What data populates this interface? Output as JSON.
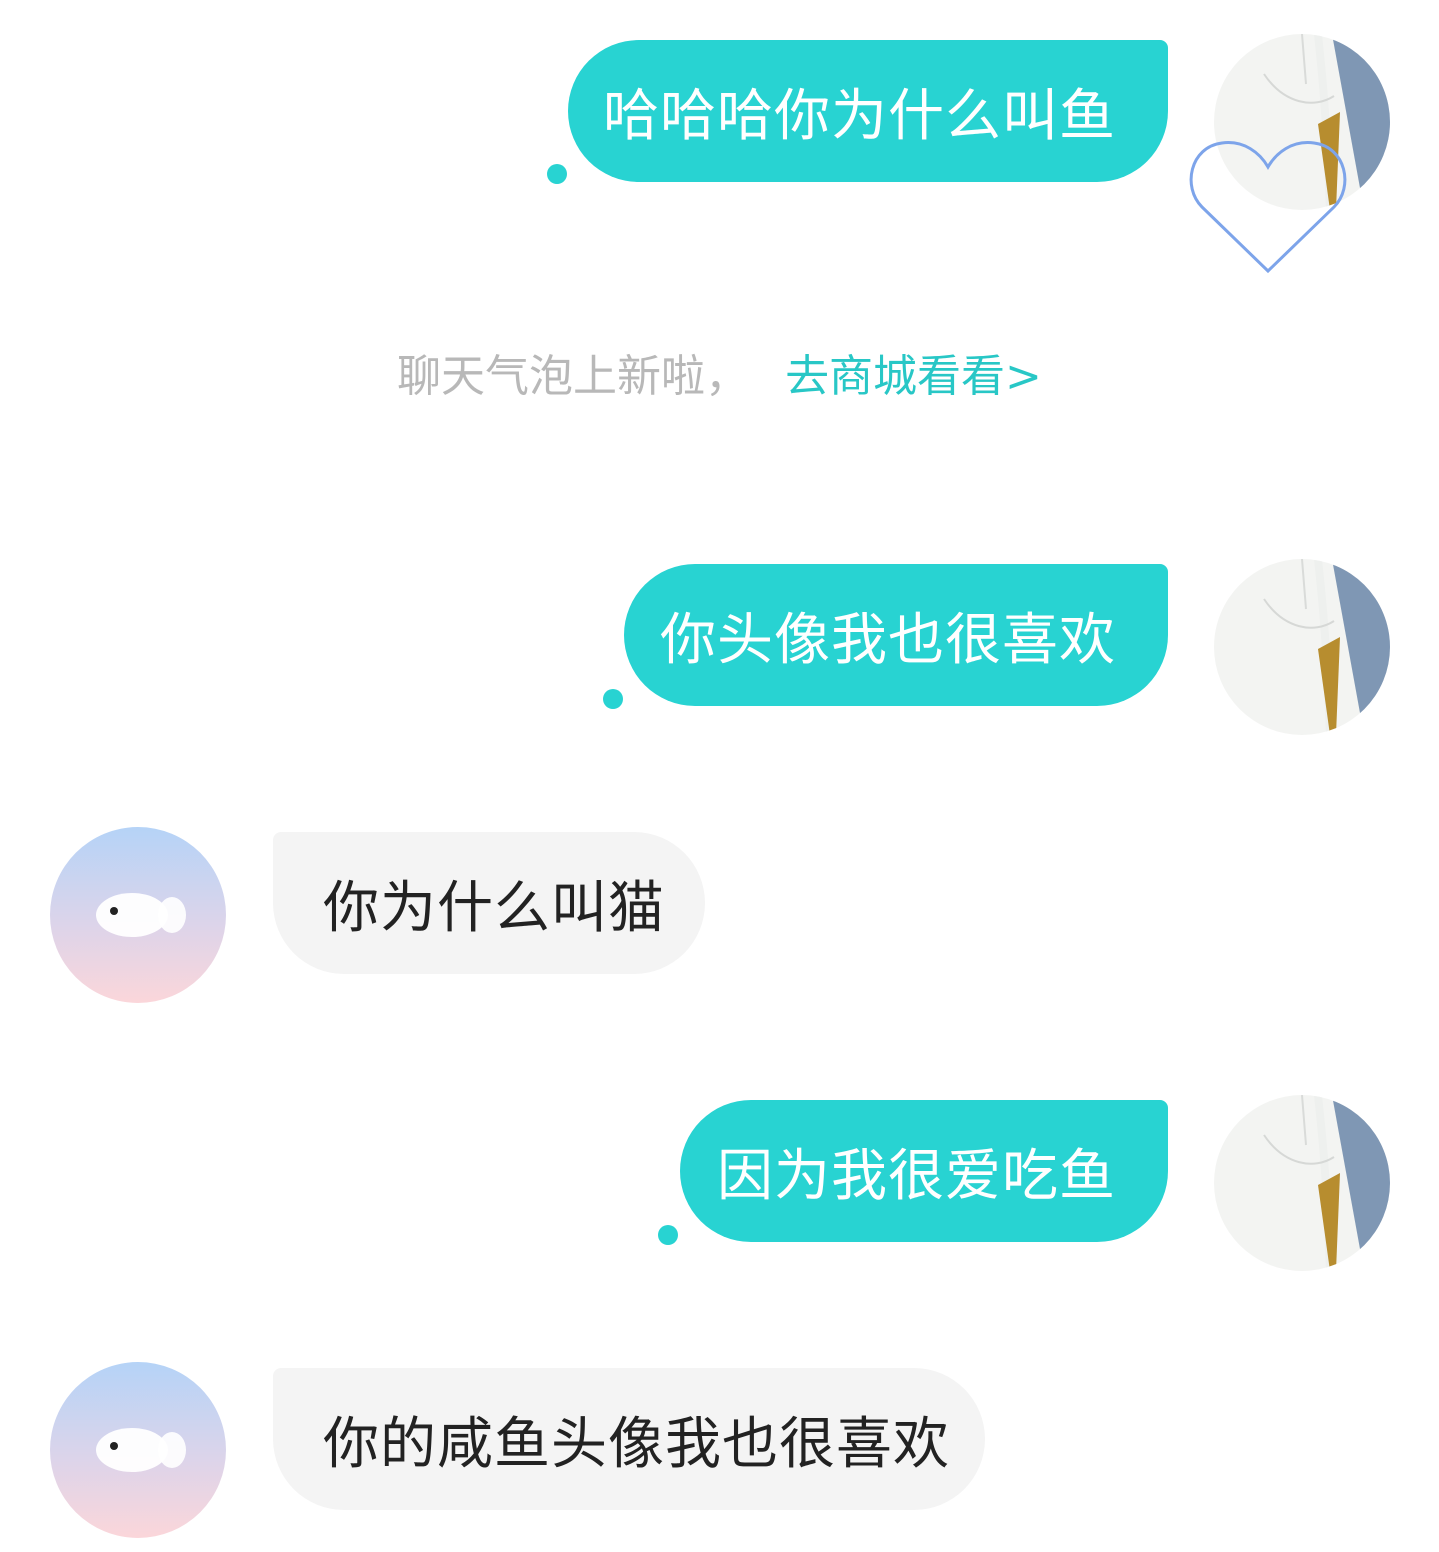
{
  "colors": {
    "sent_bubble": "#28d3d2",
    "received_bubble": "#f4f4f4",
    "link": "#28c7c6",
    "notice_text": "#b8b8b8"
  },
  "messages": [
    {
      "side": "sent",
      "text": "哈哈哈你为什么叫鱼",
      "avatar": "scarf-avatar",
      "frame": "heart-frame-icon"
    },
    {
      "side": "sent",
      "text": "你头像我也很喜欢",
      "avatar": "scarf-avatar"
    },
    {
      "side": "received",
      "text": "你为什么叫猫",
      "avatar": "fish-cloud-avatar"
    },
    {
      "side": "sent",
      "text": "因为我很爱吃鱼",
      "avatar": "scarf-avatar"
    },
    {
      "side": "received",
      "text": "你的咸鱼头像我也很喜欢",
      "avatar": "fish-cloud-avatar"
    }
  ],
  "notice": {
    "text": "聊天气泡上新啦，",
    "link": "去商城看看>"
  }
}
